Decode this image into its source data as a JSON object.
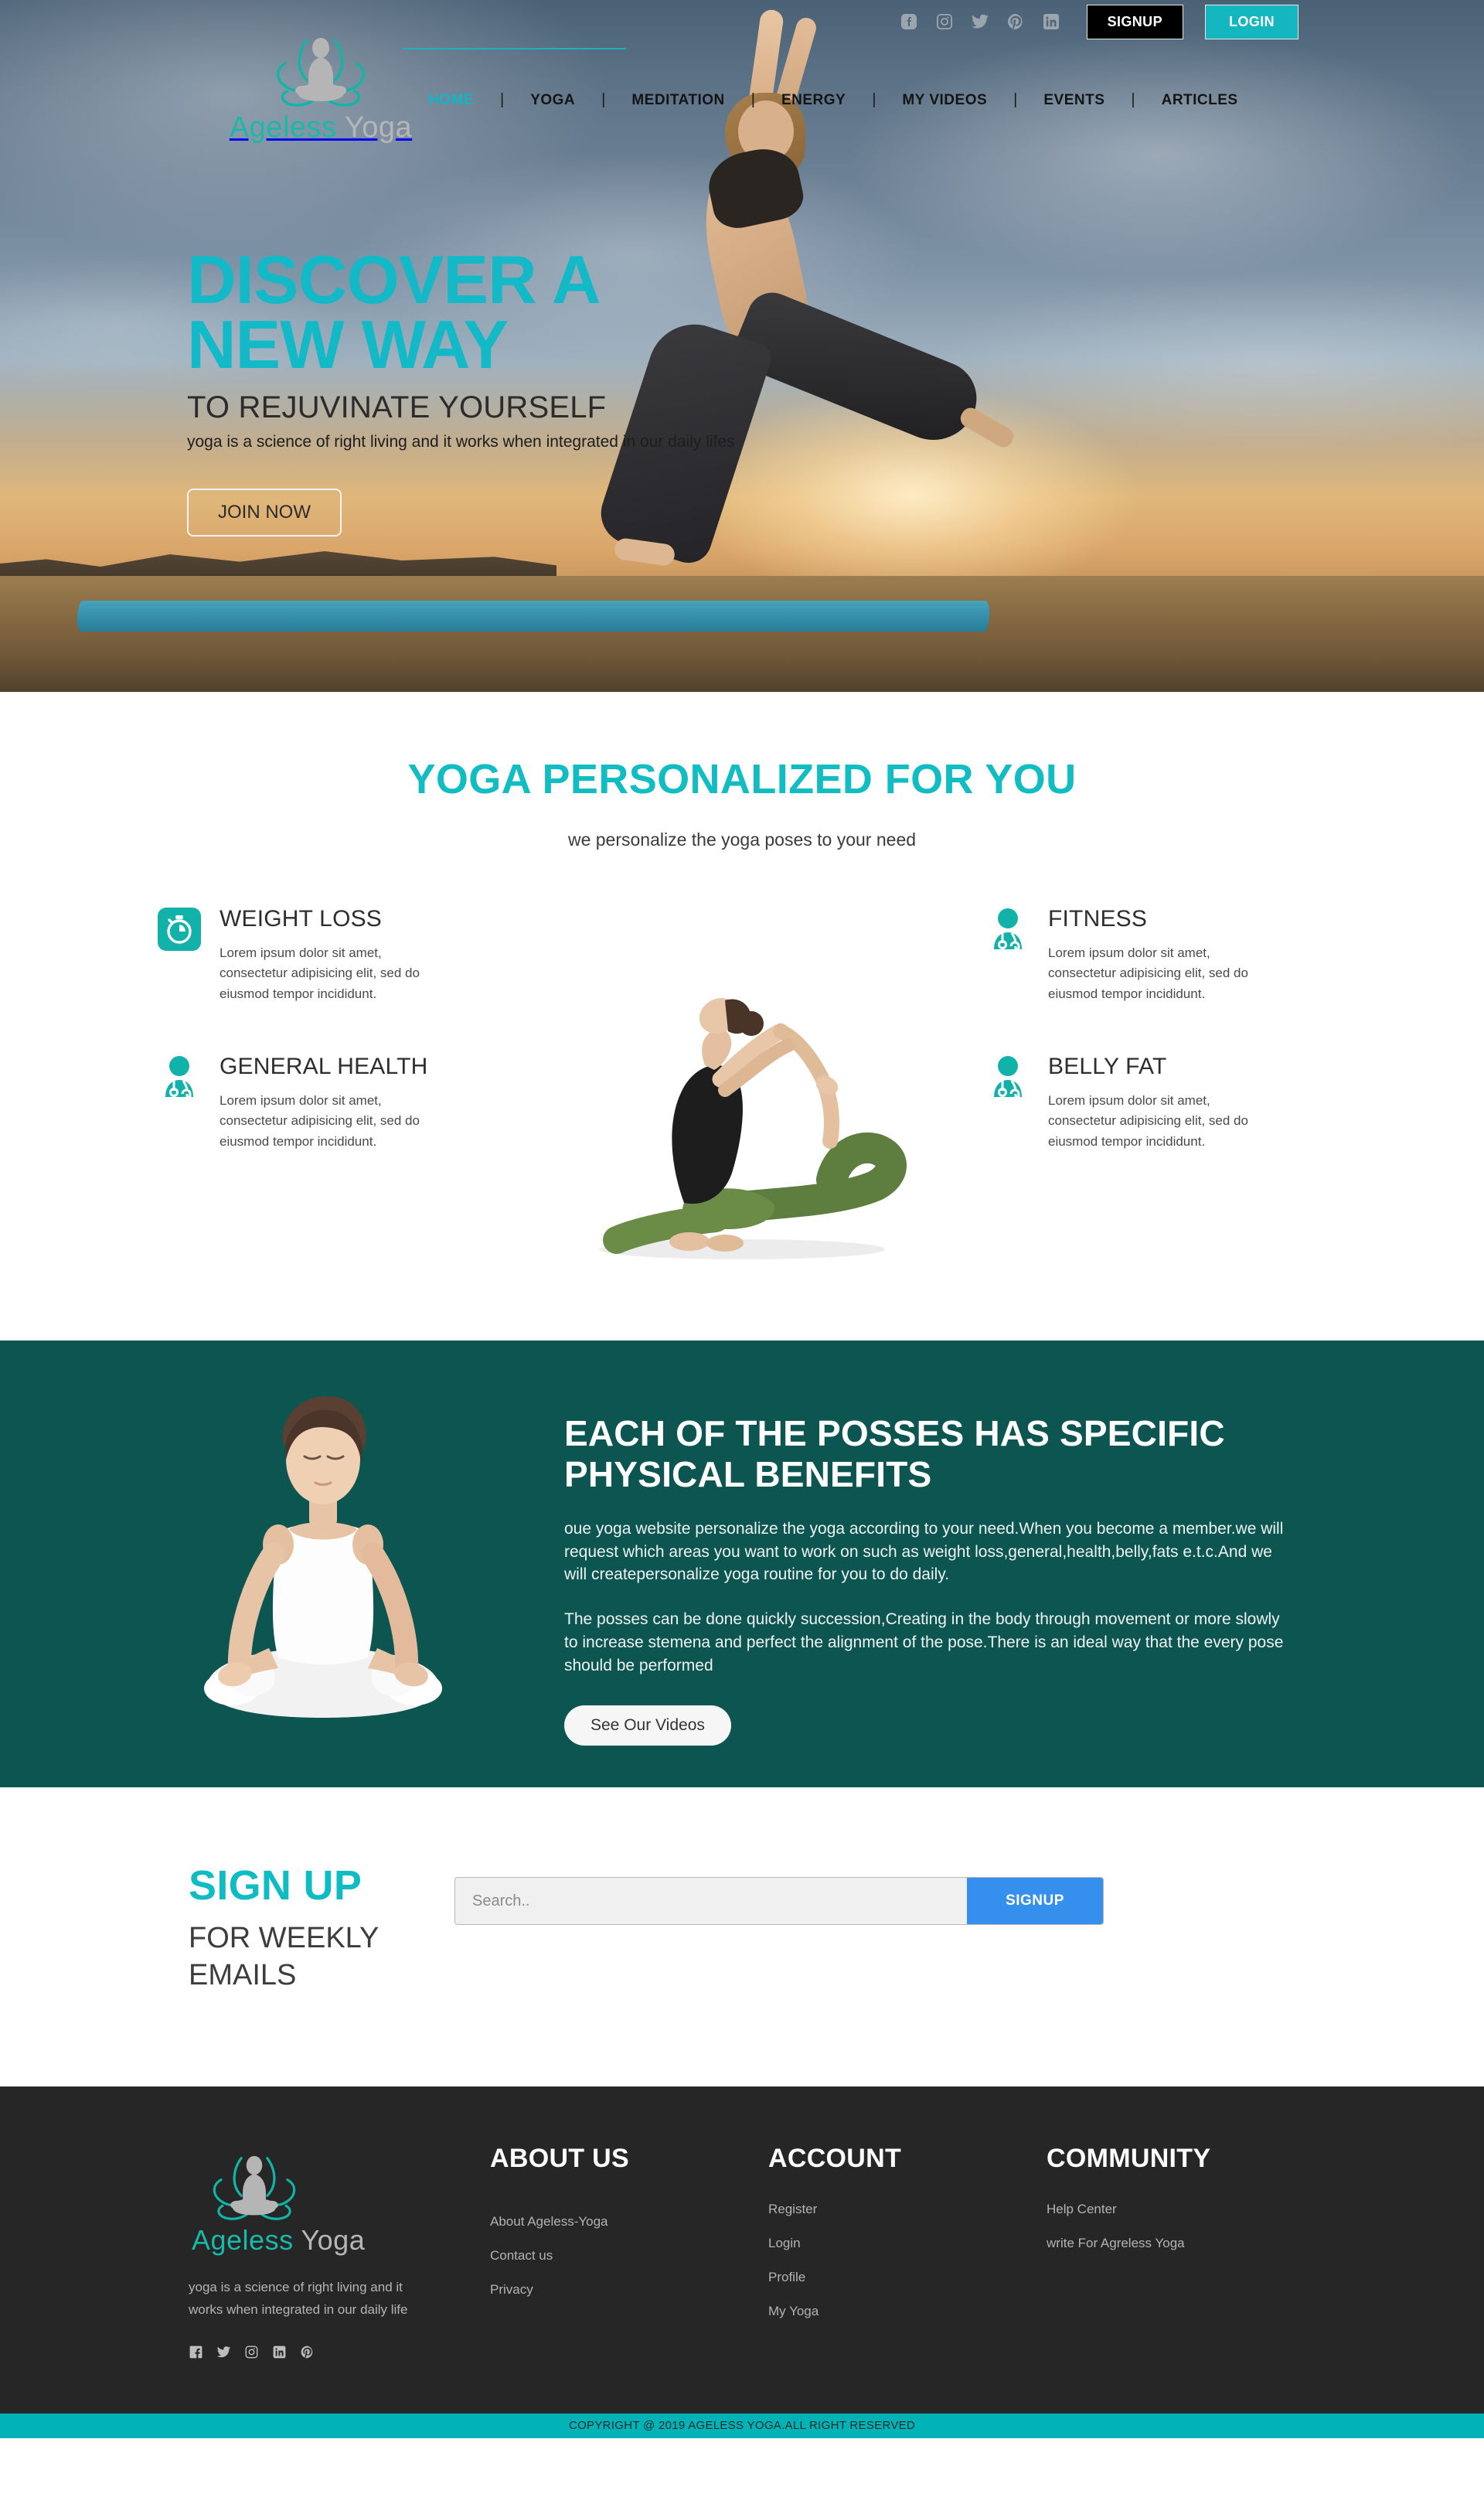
{
  "brand": {
    "name_part1": "Ageless",
    "name_part2": "Yoga",
    "logo_icon": "lotus-meditation-icon",
    "accent_color": "#12b9c4",
    "teal_dark": "#0c5550",
    "footer_bg": "#262626",
    "copyright_bar": "#01b3b7"
  },
  "header": {
    "social": [
      {
        "name": "facebook-icon",
        "label": "Facebook"
      },
      {
        "name": "instagram-icon",
        "label": "Instagram"
      },
      {
        "name": "twitter-icon",
        "label": "Twitter"
      },
      {
        "name": "pinterest-icon",
        "label": "Pinterest"
      },
      {
        "name": "linkedin-icon",
        "label": "LinkedIn"
      }
    ],
    "signup_label": "SIGNUP",
    "login_label": "LOGIN",
    "nav": [
      {
        "label": "HOME",
        "active": true
      },
      {
        "label": "YOGA",
        "active": false
      },
      {
        "label": "MEDITATION",
        "active": false
      },
      {
        "label": "ENERGY",
        "active": false
      },
      {
        "label": "MY VIDEOS",
        "active": false
      },
      {
        "label": "EVENTS",
        "active": false
      },
      {
        "label": "ARTICLES",
        "active": false
      }
    ]
  },
  "hero": {
    "title_line1": "DISCOVER A",
    "title_line2": "NEW WAY",
    "subtitle": "TO REJUVINATE YOURSELF",
    "tagline": "yoga is a science of right living and it works when integrated in our daily lifes",
    "cta_label": "JOIN NOW"
  },
  "personalized": {
    "heading": "YOGA PERSONALIZED FOR YOU",
    "lead": "we personalize the yoga poses to your need",
    "features_left": [
      {
        "icon": "stopwatch-icon",
        "title": "WEIGHT LOSS",
        "body": "Lorem ipsum dolor sit amet, consectetur adipisicing elit, sed do eiusmod tempor incididunt."
      },
      {
        "icon": "doctor-stethoscope-icon",
        "title": "GENERAL HEALTH",
        "body": "Lorem ipsum dolor sit amet, consectetur adipisicing elit, sed do eiusmod tempor incididunt."
      }
    ],
    "features_right": [
      {
        "icon": "doctor-stethoscope-icon",
        "title": "FITNESS",
        "body": "Lorem ipsum dolor sit amet, consectetur adipisicing elit, sed do eiusmod tempor incididunt."
      },
      {
        "icon": "doctor-stethoscope-icon",
        "title": "BELLY FAT",
        "body": "Lorem ipsum dolor sit amet, consectetur adipisicing elit, sed do eiusmod tempor incididunt."
      }
    ]
  },
  "benefits": {
    "heading": "EACH OF THE POSSES HAS SPECIFIC PHYSICAL BENEFITS",
    "paragraph1": "oue yoga website personalize the yoga according to your need.When you become a member.we will request which areas you want to work on such as weight loss,general,health,belly,fats e.t.c.And we will createpersonalize yoga routine for you to do daily.",
    "paragraph2": "The posses can be done quickly succession,Creating in the body through movement or more slowly to increase stemena and perfect the alignment of the pose.There is an ideal way that the every pose should be performed",
    "cta_label": "See Our Videos"
  },
  "newsletter": {
    "heading": "SIGN UP",
    "subheading": "FOR WEEKLY EMAILS",
    "input_placeholder": "Search..",
    "input_value": "",
    "button_label": "SIGNUP",
    "button_color": "#3490ec"
  },
  "footer": {
    "tagline": "yoga is a science of right living and it works when integrated in our daily life",
    "social": [
      {
        "name": "facebook-icon",
        "label": "Facebook"
      },
      {
        "name": "twitter-icon",
        "label": "Twitter"
      },
      {
        "name": "instagram-icon",
        "label": "Instagram"
      },
      {
        "name": "linkedin-icon",
        "label": "LinkedIn"
      },
      {
        "name": "pinterest-icon",
        "label": "Pinterest"
      }
    ],
    "columns": [
      {
        "title": "ABOUT US",
        "links": [
          "About Ageless-Yoga",
          "Contact us",
          "Privacy"
        ]
      },
      {
        "title": "ACCOUNT",
        "links": [
          "Register",
          "Login",
          "Profile",
          "My Yoga"
        ]
      },
      {
        "title": "COMMUNITY",
        "links": [
          "Help Center",
          "write For Agreless Yoga"
        ]
      }
    ],
    "copyright": "COPYRIGHT @ 2019 AGELESS YOGA.ALL RIGHT RESERVED"
  }
}
